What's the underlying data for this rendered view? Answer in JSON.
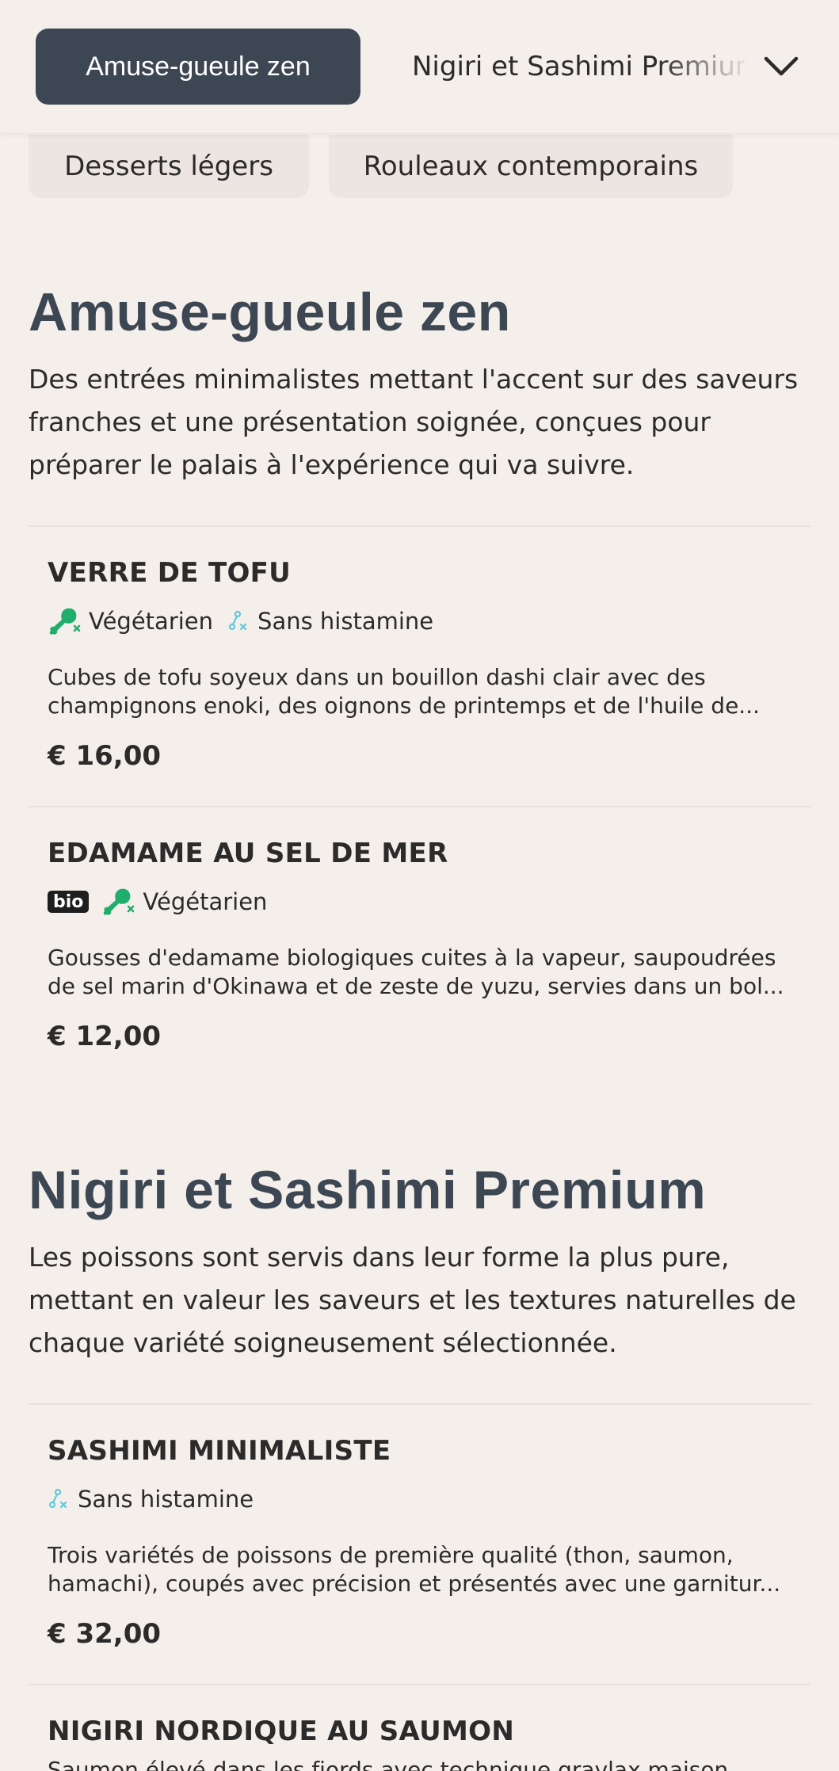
{
  "nav": {
    "active_category": "Amuse-gueule zen",
    "next_category": "Nigiri et Sashimi Premium",
    "row2": [
      "Desserts légers",
      "Rouleaux contemporains"
    ]
  },
  "sections": [
    {
      "title": "Amuse-gueule zen",
      "description": "Des entrées minimalistes mettant l'accent sur des saveurs franches et une présentation soignée, conçues pour préparer le palais à l'expérience qui va suivre.",
      "items": [
        {
          "name": "VERRE DE TOFU",
          "tags": [
            "Végétarien",
            "Sans histamine"
          ],
          "description": "Cubes de tofu soyeux dans un bouillon dashi clair avec des champignons enoki, des oignons de printemps et de l'huile de...",
          "price": "€ 16,00"
        },
        {
          "name": "EDAMAME AU SEL DE MER",
          "badge": "bio",
          "tags": [
            "Végétarien"
          ],
          "description": "Gousses d'edamame biologiques cuites à la vapeur, saupoudrées de sel marin d'Okinawa et de zeste de yuzu, servies dans un bol...",
          "price": "€ 12,00"
        }
      ]
    },
    {
      "title": "Nigiri et Sashimi Premium",
      "description": "Les poissons sont servis dans leur forme la plus pure, mettant en valeur les saveurs et les textures naturelles de chaque variété soigneusement sélectionnée.",
      "items": [
        {
          "name": "SASHIMI MINIMALISTE",
          "tags": [
            "Sans histamine"
          ],
          "description": "Trois variétés de poissons de première qualité (thon, saumon, hamachi), coupés avec précision et présentés avec une garnitur...",
          "price": "€ 32,00"
        },
        {
          "name": "NIGIRI NORDIQUE AU SAUMON",
          "description": "Saumon élevé dans les fjords avec technique gravlax maison"
        }
      ]
    }
  ],
  "icons": {
    "vegetarian": "leaf-drumstick-icon",
    "histamine": "molecule-cross-icon",
    "chevron": "chevron-down-icon"
  },
  "colors": {
    "accent": "#3d4753",
    "vegetarian_icon": "#1fae6b",
    "histamine_icon": "#5ec8d8",
    "background": "#f5efeb"
  }
}
